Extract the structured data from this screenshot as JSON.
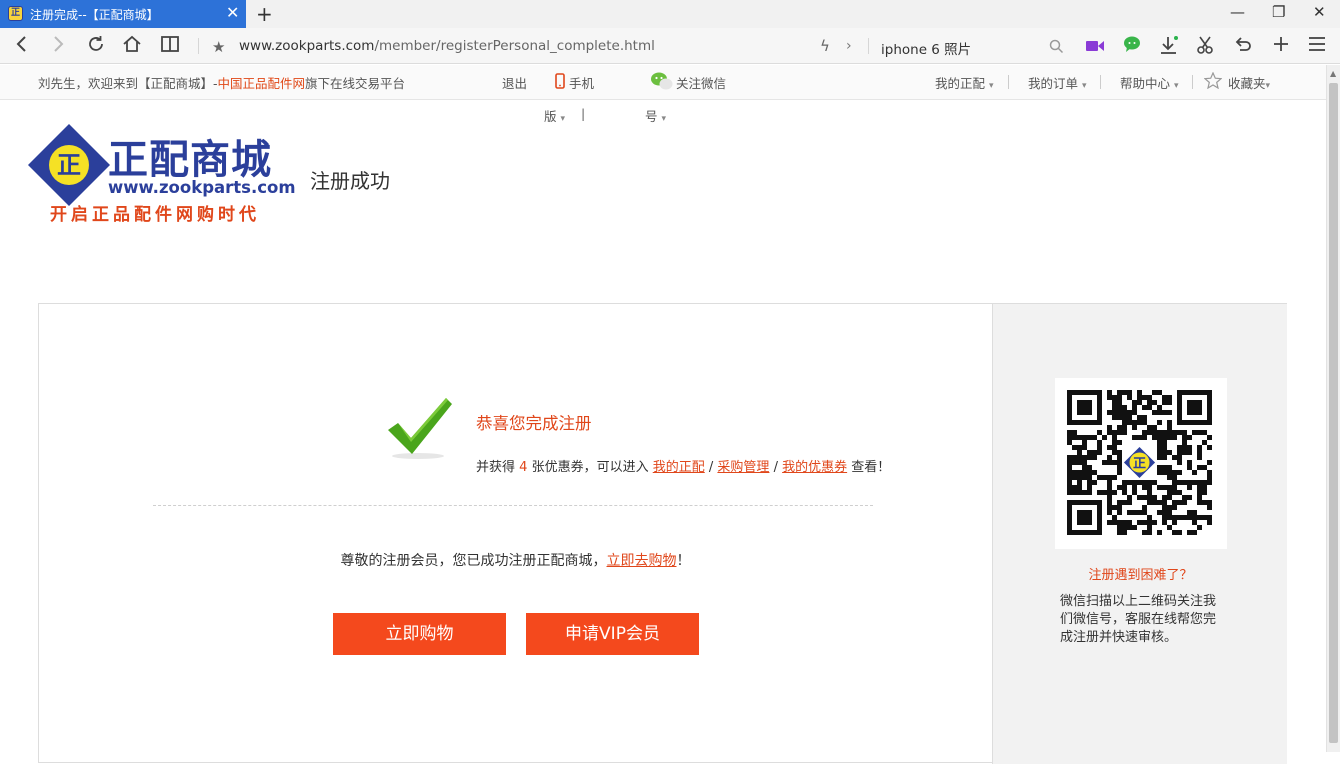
{
  "browser": {
    "tab_title": "注册完成--【正配商城】",
    "tab_favicon": "正",
    "tab_close": "✕",
    "new_tab": "+",
    "url_host": "www.zookparts.com",
    "url_path": "/member/registerPersonal_complete.html",
    "search_text": "iphone 6 照片"
  },
  "topbar": {
    "greeting_prefix": "刘先生，欢迎来到【正配商城】-",
    "greeting_highlight": "中国正品配件网",
    "greeting_suffix": "旗下在线交易平台",
    "logout": "退出",
    "mobile": "手机",
    "mobile_sub": "版",
    "wechat": "关注微信",
    "wechat_sub": "号",
    "my_zhengpei": "我的正配",
    "my_orders": "我的订单",
    "help_center": "帮助中心",
    "favorites": "收藏夹",
    "subnav_sep": "|",
    "arrow": "▾"
  },
  "header": {
    "logo_char": "正",
    "logo_title": "正配商城",
    "logo_url": "www.zookparts.com",
    "logo_slogan": "开启正品配件网购时代",
    "page_heading": "注册成功"
  },
  "main": {
    "congrats": "恭喜您完成注册",
    "coupon_prefix": "并获得",
    "coupon_count": "4",
    "coupon_suffix": "张优惠券，可以进入",
    "link_my": "我的正配",
    "link_purchase": "采购管理",
    "link_coupons": "我的优惠券",
    "link_sep": "/",
    "coupon_end": "查看！",
    "member_prefix": "尊敬的注册会员，您已成功注册正配商城，",
    "member_link": "立即去购物",
    "member_suffix": "！",
    "btn_shop": "立即购物",
    "btn_vip": "申请VIP会员"
  },
  "side": {
    "qr_center": "正",
    "help_link": "注册遇到困难了？",
    "help_text": "微信扫描以上二维码关注我们微信号，客服在线帮您完成注册并快速审核。"
  },
  "colors": {
    "accent": "#f4491d",
    "brand_blue": "#2b3f9b",
    "tab_blue": "#2d72d8"
  }
}
